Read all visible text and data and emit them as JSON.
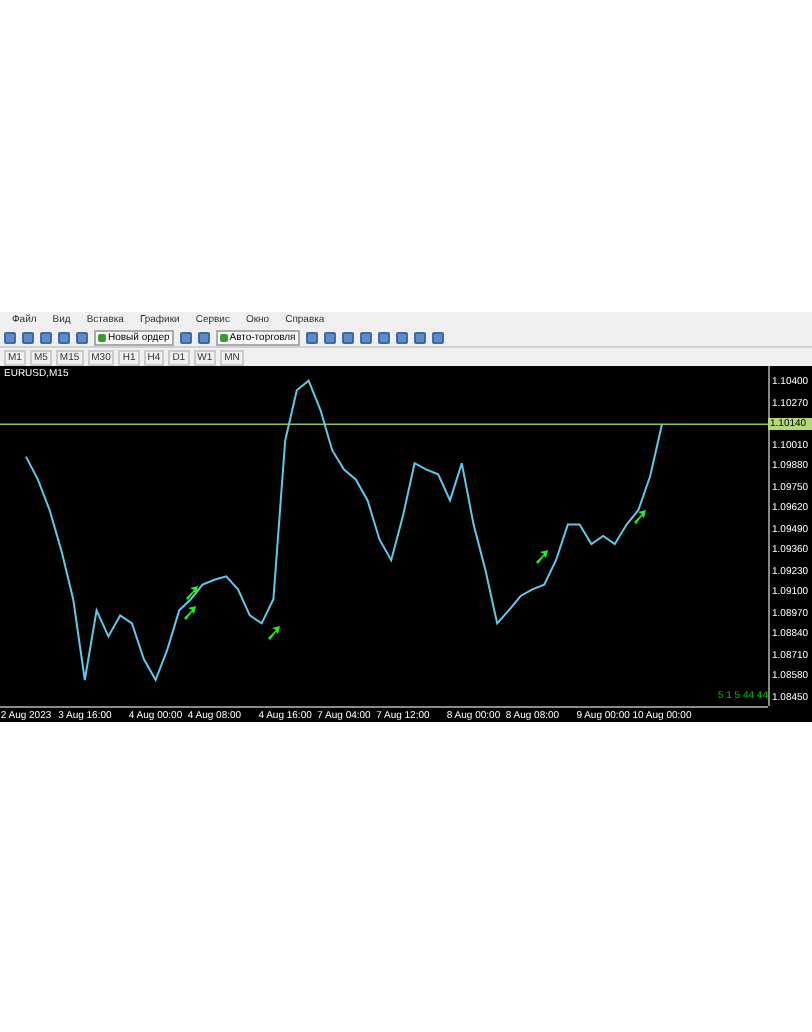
{
  "menu": [
    "Файл",
    "Вид",
    "Вставка",
    "Графики",
    "Сервис",
    "Окно",
    "Справка"
  ],
  "toolbar": {
    "buttons": [
      {
        "kind": "icon"
      },
      {
        "kind": "icon"
      },
      {
        "kind": "icon"
      },
      {
        "kind": "icon"
      },
      {
        "kind": "icon"
      },
      {
        "kind": "text",
        "label": "Новый ордер"
      },
      {
        "kind": "icon"
      },
      {
        "kind": "icon"
      },
      {
        "kind": "text",
        "label": "Авто-торговля"
      },
      {
        "kind": "icon"
      },
      {
        "kind": "icon"
      },
      {
        "kind": "icon"
      },
      {
        "kind": "icon"
      },
      {
        "kind": "icon"
      },
      {
        "kind": "icon"
      },
      {
        "kind": "icon"
      },
      {
        "kind": "icon"
      }
    ]
  },
  "timeframes": [
    "M1",
    "M5",
    "M15",
    "M30",
    "H1",
    "H4",
    "D1",
    "W1",
    "MN"
  ],
  "chart": {
    "title": "EURUSD,M15",
    "current_price": "1.10140",
    "corner_text": "5 1 5 44 44",
    "chart_data": {
      "type": "line",
      "categories": [
        "2 Aug 2023",
        null,
        null,
        null,
        null,
        "3 Aug 16:00",
        null,
        null,
        null,
        null,
        null,
        "4 Aug 00:00",
        null,
        null,
        null,
        null,
        "4 Aug 08:00",
        null,
        null,
        null,
        null,
        null,
        "4 Aug 16:00",
        null,
        null,
        null,
        null,
        "7 Aug 04:00",
        null,
        null,
        null,
        null,
        "7 Aug 12:00",
        null,
        null,
        null,
        null,
        null,
        "8 Aug 00:00",
        null,
        null,
        null,
        null,
        "8 Aug 08:00",
        null,
        null,
        null,
        null,
        null,
        "9 Aug 00:00",
        null,
        null,
        null,
        null,
        "10 Aug 00:00"
      ],
      "ylim": [
        1.084,
        1.105
      ],
      "ref_lines": [
        {
          "axis": "y",
          "value": 1.1014,
          "color": "#8fbf5a"
        }
      ],
      "yticks": [
        {
          "value": 1.104,
          "label": "1.10400"
        },
        {
          "value": 1.1027,
          "label": "1.10270"
        },
        {
          "value": 1.1001,
          "label": "1.10010"
        },
        {
          "value": 1.0988,
          "label": "1.09880"
        },
        {
          "value": 1.0975,
          "label": "1.09750"
        },
        {
          "value": 1.0962,
          "label": "1.09620"
        },
        {
          "value": 1.0949,
          "label": "1.09490"
        },
        {
          "value": 1.0936,
          "label": "1.09360"
        },
        {
          "value": 1.0923,
          "label": "1.09230"
        },
        {
          "value": 1.091,
          "label": "1.09100"
        },
        {
          "value": 1.0897,
          "label": "1.08970"
        },
        {
          "value": 1.0884,
          "label": "1.08840"
        },
        {
          "value": 1.0871,
          "label": "1.08710"
        },
        {
          "value": 1.0858,
          "label": "1.08580"
        },
        {
          "value": 1.0845,
          "label": "1.08450"
        }
      ],
      "series": [
        {
          "color": "#60c8e8",
          "values": [
            1.0994,
            1.098,
            1.0961,
            1.0936,
            1.0906,
            1.0856,
            1.0899,
            1.0883,
            1.0896,
            1.0891,
            1.0869,
            1.0856,
            1.0875,
            1.0899,
            1.0906,
            1.0915,
            1.0918,
            1.092,
            1.0912,
            1.0896,
            1.0891,
            1.0906,
            1.1004,
            1.1035,
            1.1041,
            1.1023,
            1.0998,
            1.0986,
            1.098,
            1.0967,
            1.0943,
            1.093,
            1.0957,
            1.099,
            1.0986,
            1.0983,
            1.0967,
            1.099,
            1.0952,
            1.0924,
            1.0891,
            1.0899,
            1.0908,
            1.0912,
            1.0915,
            1.093,
            1.0952,
            1.0952,
            1.094,
            1.0945,
            1.094,
            1.0952,
            1.0961,
            1.0982,
            1.1014
          ]
        }
      ]
    }
  }
}
